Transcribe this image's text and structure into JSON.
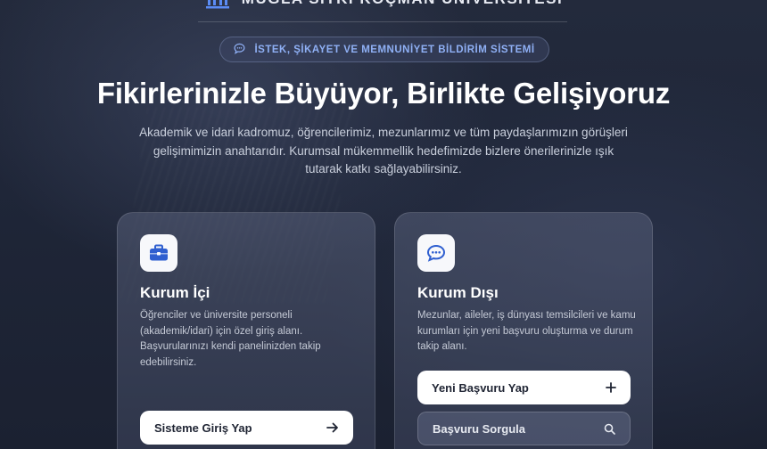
{
  "brand": {
    "name": "MUĞLA SITKI KOÇMAN ÜNİVERSİTESİ",
    "logo_icon": "university-building-icon"
  },
  "badge": {
    "icon": "chat-bubble-icon",
    "text": "İSTEK, ŞİKAYET VE MEMNUNİYET BİLDİRİM SİSTEMİ"
  },
  "hero": {
    "title": "Fikirlerinizle Büyüyor, Birlikte Gelişiyoruz",
    "description": "Akademik ve idari kadromuz, öğrencilerimiz, mezunlarımız ve tüm paydaşlarımızın görüşleri gelişimimizin anahtarıdır. Kurumsal mükemmellik hedefimizde bizlere önerilerinizle ışık tutarak katkı sağlayabilirsiniz."
  },
  "cards": [
    {
      "icon": "briefcase-icon",
      "title": "Kurum İçi",
      "description": "Öğrenciler ve üniversite personeli (akademik/idari) için özel giriş alanı. Başvurularınızı kendi panelinizden takip edebilirsiniz.",
      "buttons": [
        {
          "label": "Sisteme Giriş Yap",
          "icon": "arrow-right-icon"
        }
      ]
    },
    {
      "icon": "chat-dots-icon",
      "title": "Kurum Dışı",
      "description": "Mezunlar, aileler, iş dünyası temsilcileri ve kamu kurumları için yeni başvuru oluşturma ve durum takip alanı.",
      "buttons": [
        {
          "label": "Yeni Başvuru Yap",
          "icon": "plus-icon"
        },
        {
          "label": "Başvuru Sorgula",
          "icon": "search-icon"
        }
      ]
    }
  ],
  "colors": {
    "accent": "#8fb0f5",
    "background": "#1f2638",
    "button_primary": "#ffffff",
    "icon_blue": "#2f5fd0"
  }
}
